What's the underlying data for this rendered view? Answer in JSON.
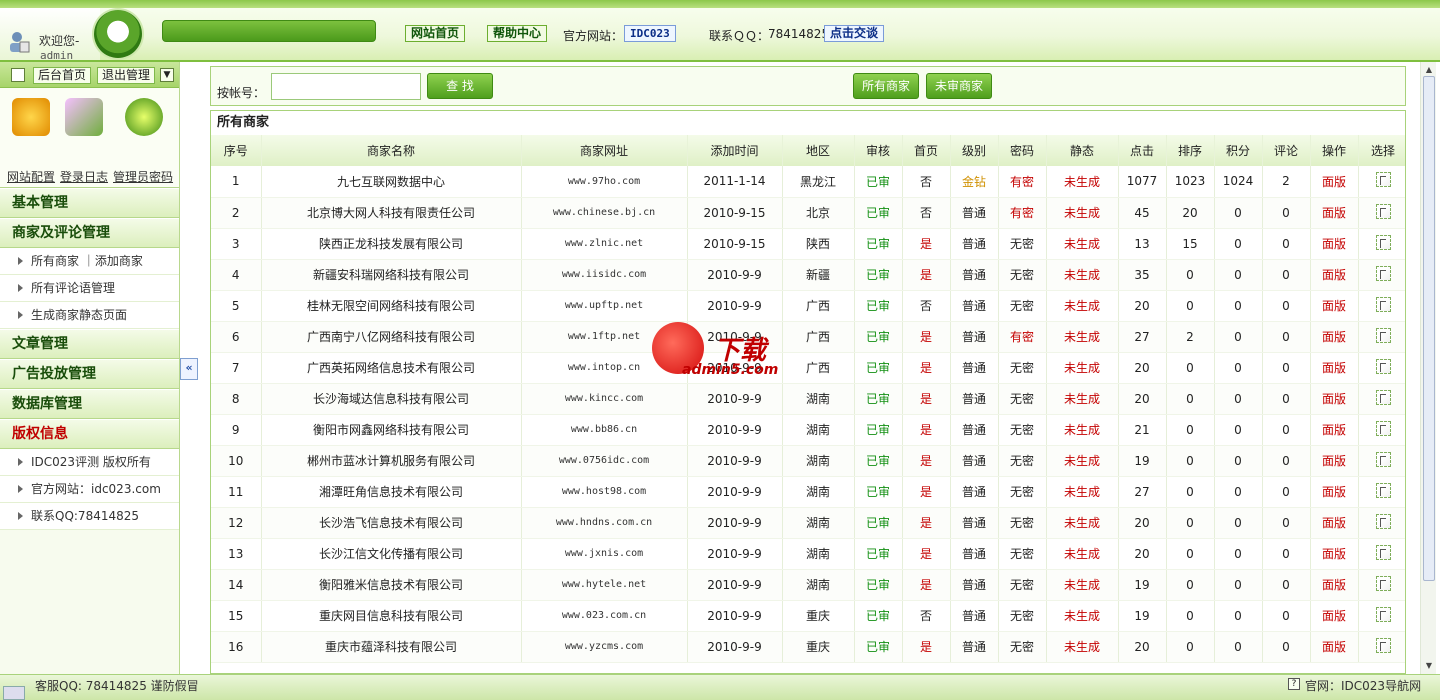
{
  "header": {
    "welcome": "欢迎您-",
    "username": "admin",
    "nav_home": "网站首页",
    "nav_help": "帮助中心",
    "official_label": "官方网站：",
    "official_value": "IDC023",
    "contact_label": "联系ＱＱ：",
    "contact_qq": "78414825",
    "contact_button": "点击交谈"
  },
  "sidebar": {
    "btn_home": "后台首页",
    "btn_logout": "退出管理",
    "quick_links": [
      "网站配置",
      "登录日志",
      "管理员密码"
    ],
    "sections": [
      {
        "title": "基本管理",
        "items": []
      },
      {
        "title": "商家及评论管理",
        "items": [
          "所有商家 ｜添加商家",
          "所有评论语管理",
          "生成商家静态页面"
        ]
      },
      {
        "title": "文章管理",
        "items": []
      },
      {
        "title": "广告投放管理",
        "items": []
      },
      {
        "title": "数据库管理",
        "items": []
      },
      {
        "title": "版权信息",
        "items": [
          "IDC023评测 版权所有",
          "官方网站：idc023.com",
          "联系QQ:78414825"
        ]
      }
    ]
  },
  "search": {
    "label": "按帐号：",
    "input_value": "",
    "search_button": "查 找",
    "all_button": "所有商家",
    "pending_button": "未审商家"
  },
  "list": {
    "title": "所有商家",
    "columns": [
      "序号",
      "商家名称",
      "商家网址",
      "添加时间",
      "地区",
      "审核",
      "首页",
      "级别",
      "密码",
      "静态",
      "点击",
      "排序",
      "积分",
      "评论",
      "操作",
      "选择"
    ],
    "rows": [
      [
        "1",
        "九七互联网数据中心",
        "www.97ho.com",
        "2011-1-14",
        "黑龙江",
        "已审",
        "否",
        "金钻",
        "有密",
        "未生成",
        "1077",
        "1023",
        "1024",
        "2",
        "面版"
      ],
      [
        "2",
        "北京博大网人科技有限责任公司",
        "www.chinese.bj.cn",
        "2010-9-15",
        "北京",
        "已审",
        "否",
        "普通",
        "有密",
        "未生成",
        "45",
        "20",
        "0",
        "0",
        "面版"
      ],
      [
        "3",
        "陕西正龙科技发展有限公司",
        "www.zlnic.net",
        "2010-9-15",
        "陕西",
        "已审",
        "是",
        "普通",
        "无密",
        "未生成",
        "13",
        "15",
        "0",
        "0",
        "面版"
      ],
      [
        "4",
        "新疆安科瑞网络科技有限公司",
        "www.iisidc.com",
        "2010-9-9",
        "新疆",
        "已审",
        "是",
        "普通",
        "无密",
        "未生成",
        "35",
        "0",
        "0",
        "0",
        "面版"
      ],
      [
        "5",
        "桂林无限空间网络科技有限公司",
        "www.upftp.net",
        "2010-9-9",
        "广西",
        "已审",
        "否",
        "普通",
        "无密",
        "未生成",
        "20",
        "0",
        "0",
        "0",
        "面版"
      ],
      [
        "6",
        "广西南宁八亿网络科技有限公司",
        "www.1ftp.net",
        "2010-9-9",
        "广西",
        "已审",
        "是",
        "普通",
        "有密",
        "未生成",
        "27",
        "2",
        "0",
        "0",
        "面版"
      ],
      [
        "7",
        "广西英拓网络信息技术有限公司",
        "www.intop.cn",
        "2010-9-9",
        "广西",
        "已审",
        "是",
        "普通",
        "无密",
        "未生成",
        "20",
        "0",
        "0",
        "0",
        "面版"
      ],
      [
        "8",
        "长沙海域达信息科技有限公司",
        "www.kincc.com",
        "2010-9-9",
        "湖南",
        "已审",
        "是",
        "普通",
        "无密",
        "未生成",
        "20",
        "0",
        "0",
        "0",
        "面版"
      ],
      [
        "9",
        "衡阳市网鑫网络科技有限公司",
        "www.bb86.cn",
        "2010-9-9",
        "湖南",
        "已审",
        "是",
        "普通",
        "无密",
        "未生成",
        "21",
        "0",
        "0",
        "0",
        "面版"
      ],
      [
        "10",
        "郴州市蓝冰计算机服务有限公司",
        "www.0756idc.com",
        "2010-9-9",
        "湖南",
        "已审",
        "是",
        "普通",
        "无密",
        "未生成",
        "19",
        "0",
        "0",
        "0",
        "面版"
      ],
      [
        "11",
        "湘潭旺角信息技术有限公司",
        "www.host98.com",
        "2010-9-9",
        "湖南",
        "已审",
        "是",
        "普通",
        "无密",
        "未生成",
        "27",
        "0",
        "0",
        "0",
        "面版"
      ],
      [
        "12",
        "长沙浩飞信息技术有限公司",
        "www.hndns.com.cn",
        "2010-9-9",
        "湖南",
        "已审",
        "是",
        "普通",
        "无密",
        "未生成",
        "20",
        "0",
        "0",
        "0",
        "面版"
      ],
      [
        "13",
        "长沙江信文化传播有限公司",
        "www.jxnis.com",
        "2010-9-9",
        "湖南",
        "已审",
        "是",
        "普通",
        "无密",
        "未生成",
        "20",
        "0",
        "0",
        "0",
        "面版"
      ],
      [
        "14",
        "衡阳雅米信息技术有限公司",
        "www.hytele.net",
        "2010-9-9",
        "湖南",
        "已审",
        "是",
        "普通",
        "无密",
        "未生成",
        "19",
        "0",
        "0",
        "0",
        "面版"
      ],
      [
        "15",
        "重庆网目信息科技有限公司",
        "www.023.com.cn",
        "2010-9-9",
        "重庆",
        "已审",
        "否",
        "普通",
        "无密",
        "未生成",
        "19",
        "0",
        "0",
        "0",
        "面版"
      ],
      [
        "16",
        "重庆市蕴泽科技有限公司",
        "www.yzcms.com",
        "2010-9-9",
        "重庆",
        "已审",
        "是",
        "普通",
        "无密",
        "未生成",
        "20",
        "0",
        "0",
        "0",
        "面版"
      ]
    ]
  },
  "watermark": {
    "top": "下载",
    "bottom": "admin5.com"
  },
  "status": {
    "left": "客服QQ: 78414825 谨防假冒",
    "right": "官网：IDC023导航网"
  },
  "colors": {
    "accent": "#5aa52a",
    "approved": "#139013",
    "alert": "#c40000",
    "gold": "#d09000"
  }
}
